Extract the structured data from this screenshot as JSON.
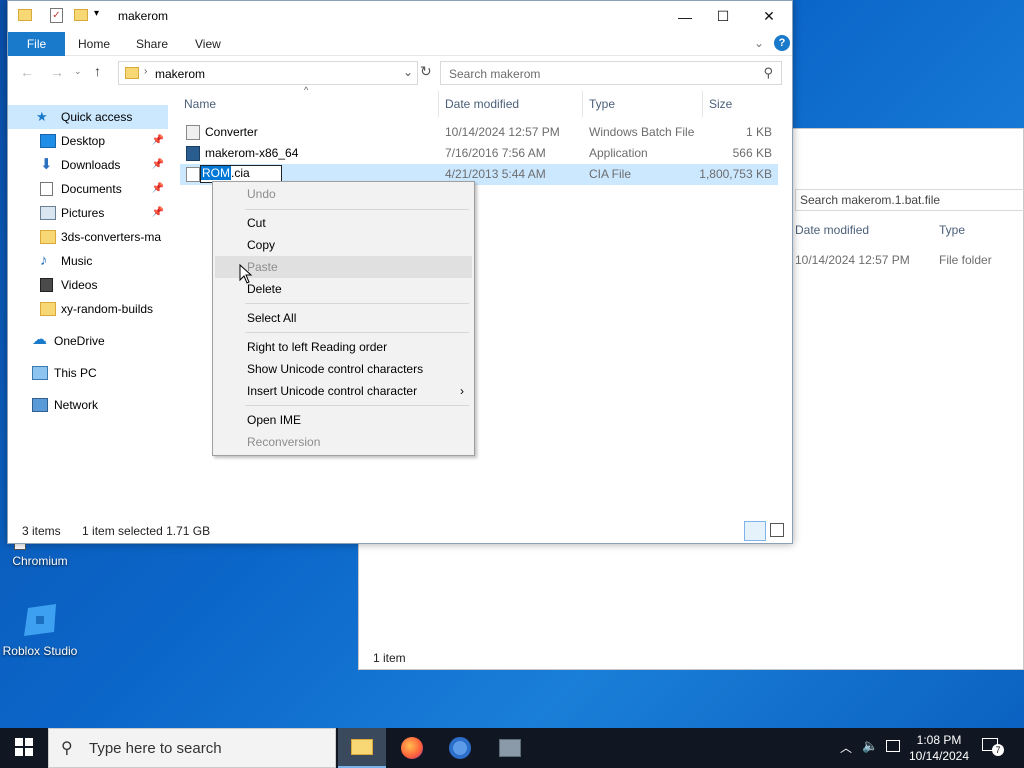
{
  "desktop": {
    "icons": [
      {
        "label": "Chromium",
        "icon": "chromium-shortcut-icon"
      },
      {
        "label": "Roblox Studio",
        "icon": "roblox-studio-icon"
      }
    ]
  },
  "back_window": {
    "search_placeholder": "Search makerom.1.bat.file",
    "columns": [
      "Date modified",
      "Type"
    ],
    "row": {
      "date": "10/14/2024 12:57 PM",
      "type": "File folder"
    },
    "status": "1 item"
  },
  "window": {
    "title": "makerom",
    "controls": {
      "minimize": "—",
      "maximize": "☐",
      "close": "✕"
    },
    "ribbon": {
      "file": "File",
      "tabs": [
        "Home",
        "Share",
        "View"
      ]
    },
    "address": {
      "path": "makerom"
    },
    "search": {
      "placeholder": "Search makerom"
    },
    "nav": [
      {
        "label": "Quick access",
        "icon": "star-icon",
        "pinned": false
      },
      {
        "label": "Desktop",
        "icon": "desktop-icon",
        "pinned": true
      },
      {
        "label": "Downloads",
        "icon": "download-icon",
        "pinned": true
      },
      {
        "label": "Documents",
        "icon": "documents-icon",
        "pinned": true
      },
      {
        "label": "Pictures",
        "icon": "pictures-icon",
        "pinned": true
      },
      {
        "label": "3ds-converters-ma",
        "icon": "folder-icon",
        "pinned": false
      },
      {
        "label": "Music",
        "icon": "music-icon",
        "pinned": false
      },
      {
        "label": "Videos",
        "icon": "videos-icon",
        "pinned": false
      },
      {
        "label": "xy-random-builds",
        "icon": "folder-icon",
        "pinned": false
      },
      {
        "label": "OneDrive",
        "icon": "cloud-icon",
        "pinned": false
      },
      {
        "label": "This PC",
        "icon": "computer-icon",
        "pinned": false
      },
      {
        "label": "Network",
        "icon": "network-icon",
        "pinned": false
      }
    ],
    "columns": {
      "name": "Name",
      "date": "Date modified",
      "type": "Type",
      "size": "Size"
    },
    "files": [
      {
        "name": "Converter",
        "date": "10/14/2024 12:57 PM",
        "type": "Windows Batch File",
        "size": "1 KB"
      },
      {
        "name": "makerom-x86_64",
        "date": "7/16/2016 7:56 AM",
        "type": "Application",
        "size": "566 KB"
      },
      {
        "name_selected": "ROM",
        "name_rest": ".cia",
        "date": "4/21/2013 5:44 AM",
        "type": "CIA File",
        "size": "1,800,753 KB"
      }
    ],
    "status": {
      "items": "3 items",
      "selected": "1 item selected  1.71 GB"
    }
  },
  "context_menu": {
    "items": {
      "undo": "Undo",
      "cut": "Cut",
      "copy": "Copy",
      "paste": "Paste",
      "delete": "Delete",
      "select_all": "Select All",
      "rtl": "Right to left Reading order",
      "show_unicode": "Show Unicode control characters",
      "insert_unicode": "Insert Unicode control character",
      "open_ime": "Open IME",
      "reconversion": "Reconversion"
    }
  },
  "taskbar": {
    "search_placeholder": "Type here to search",
    "time": "1:08 PM",
    "date": "10/14/2024",
    "notification_count": "7"
  },
  "colors": {
    "accent": "#1979ca",
    "selection": "#cce8ff",
    "highlight": "#0078d7"
  }
}
